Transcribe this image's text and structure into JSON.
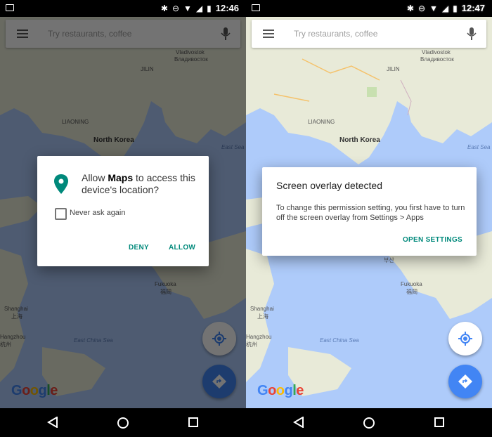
{
  "status_bar": {
    "left_time": "12:46",
    "right_time": "12:47"
  },
  "search": {
    "placeholder": "Try restaurants, coffee"
  },
  "map_labels": {
    "vladivostok": "Vladivostok",
    "vladivostok_ru": "Владивосток",
    "jilin": "JILIN",
    "liaoning": "LIAONING",
    "north_korea": "North Korea",
    "east_sea": "East Sea",
    "busan": "부산",
    "fukuoka": "Fukuoka",
    "fukuoka_jp": "福岡",
    "shanghai": "Shanghai",
    "shanghai_cn": "上海",
    "hangzhou": "Hangzhou",
    "hangzhou_cn": "杭州",
    "east_china_sea": "East China Sea"
  },
  "google_logo": "Google",
  "permission_dialog": {
    "title_prefix": "Allow ",
    "app_name": "Maps",
    "title_suffix": " to access this device's location?",
    "checkbox_label": "Never ask again",
    "deny": "DENY",
    "allow": "ALLOW"
  },
  "overlay_dialog": {
    "title": "Screen overlay detected",
    "body": "To change this permission setting, you first have to turn off the screen overlay from Settings > Apps",
    "button": "OPEN SETTINGS"
  },
  "colors": {
    "accent_teal": "#00897b",
    "fab_blue": "#4285f4",
    "water": "#aecbfa",
    "land": "#e8ead8"
  }
}
